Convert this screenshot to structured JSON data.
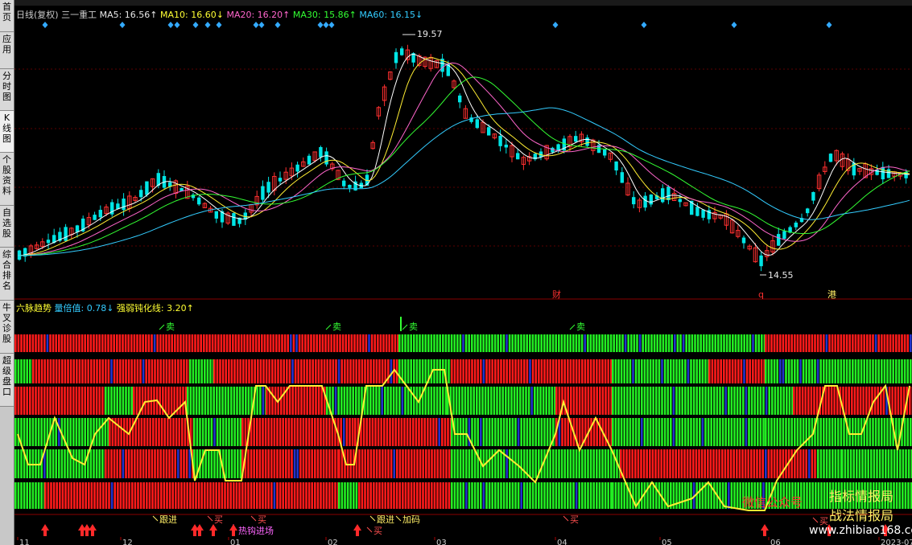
{
  "sidebar": [
    {
      "label": "首页"
    },
    {
      "label": "应用"
    },
    {
      "label": "分时图"
    },
    {
      "label": "K线图"
    },
    {
      "label": "个股资料"
    },
    {
      "label": "自选股"
    },
    {
      "label": "综合排名"
    },
    {
      "label": "牛叉诊股"
    },
    {
      "label": "超级盘口"
    }
  ],
  "main_header": {
    "period": "日线(复权)",
    "stock": "三一重工",
    "ma5": "MA5: 16.56↑",
    "ma10": "MA10: 16.60↓",
    "ma20": "MA20: 16.20↑",
    "ma30": "MA30: 15.86↑",
    "ma60": "MA60: 16.15↓"
  },
  "indicator_header": {
    "name": "六脉趋势",
    "volume_ratio": "量倍值: 0.78↓",
    "strength": "强弱钝化线: 3.20↑"
  },
  "price_annotations": {
    "high": "19.57",
    "low": "14.55"
  },
  "event_markers": [
    {
      "label": "财",
      "color": "#ff3030"
    },
    {
      "label": "q",
      "color": "#ff3030"
    },
    {
      "label": "港",
      "color": "#ffee66"
    }
  ],
  "signals": {
    "sell": "卖",
    "buy": "买",
    "follow": "跟进",
    "add": "加码",
    "hot_money": "热钩进场"
  },
  "x_axis": [
    "11",
    "12",
    "01",
    "02",
    "03",
    "04",
    "05",
    "06",
    "2023-07"
  ],
  "watermarks": {
    "wechat": "微信公众号",
    "line1": "指标情报局",
    "line2": "战法情报局",
    "url": "www.zhibiao168.com"
  },
  "colors": {
    "up": "#ff3030",
    "down": "#00e5e5",
    "bull": "#ff1a1a",
    "bear": "#22ee22",
    "line": "#ffee33"
  }
}
